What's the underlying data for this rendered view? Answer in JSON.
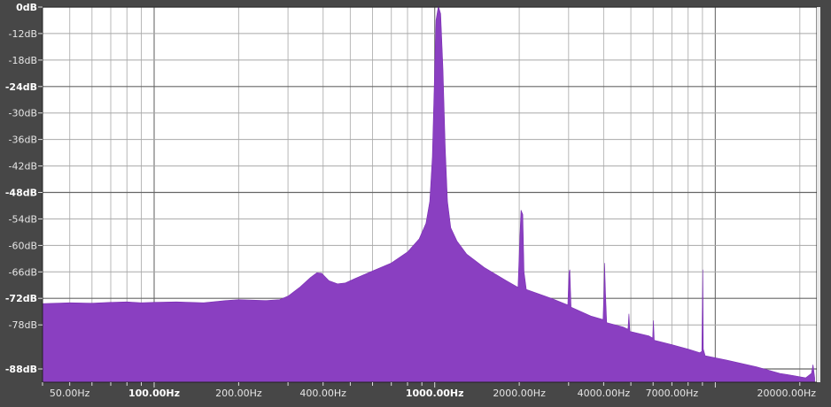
{
  "chart_data": {
    "type": "area",
    "title": "",
    "xlabel": "",
    "ylabel": "",
    "x_scale": "log",
    "xlim": [
      40,
      23000
    ],
    "ylim": [
      -91,
      -6
    ],
    "grid": true,
    "y_ticks": [
      {
        "value": -6,
        "label": "0dB",
        "major": true
      },
      {
        "value": -12,
        "label": "-12dB",
        "major": false
      },
      {
        "value": -18,
        "label": "-18dB",
        "major": false
      },
      {
        "value": -24,
        "label": "-24dB",
        "major": true
      },
      {
        "value": -30,
        "label": "-30dB",
        "major": false
      },
      {
        "value": -36,
        "label": "-36dB",
        "major": false
      },
      {
        "value": -42,
        "label": "-42dB",
        "major": false
      },
      {
        "value": -48,
        "label": "-48dB",
        "major": true
      },
      {
        "value": -54,
        "label": "-54dB",
        "major": false
      },
      {
        "value": -60,
        "label": "-60dB",
        "major": false
      },
      {
        "value": -66,
        "label": "-66dB",
        "major": false
      },
      {
        "value": -72,
        "label": "-72dB",
        "major": true
      },
      {
        "value": -78,
        "label": "-78dB",
        "major": false
      },
      {
        "value": -88,
        "label": "-88dB",
        "major": true
      }
    ],
    "x_ticks": [
      {
        "value": 50,
        "label": "50.00Hz",
        "major": false
      },
      {
        "value": 100,
        "label": "100.00Hz",
        "major": true
      },
      {
        "value": 200,
        "label": "200.00Hz",
        "major": false
      },
      {
        "value": 400,
        "label": "400.00Hz",
        "major": false
      },
      {
        "value": 1000,
        "label": "1000.00Hz",
        "major": true
      },
      {
        "value": 2000,
        "label": "2000.00Hz",
        "major": false
      },
      {
        "value": 4000,
        "label": "4000.00Hz",
        "major": false
      },
      {
        "value": 7000,
        "label": "7000.00Hz",
        "major": false
      },
      {
        "value": 20000,
        "label": "20000.00Hz",
        "major": false
      }
    ],
    "series": [
      {
        "color": "#8a3fc1",
        "points": [
          [
            40,
            -73.2
          ],
          [
            50,
            -73.0
          ],
          [
            60,
            -73.1
          ],
          [
            70,
            -72.9
          ],
          [
            80,
            -72.8
          ],
          [
            90,
            -73.0
          ],
          [
            100,
            -72.9
          ],
          [
            120,
            -72.8
          ],
          [
            150,
            -73.0
          ],
          [
            180,
            -72.5
          ],
          [
            200,
            -72.3
          ],
          [
            250,
            -72.5
          ],
          [
            280,
            -72.3
          ],
          [
            300,
            -71.5
          ],
          [
            330,
            -69.5
          ],
          [
            360,
            -67.3
          ],
          [
            380,
            -66.2
          ],
          [
            395,
            -66.3
          ],
          [
            420,
            -68.0
          ],
          [
            450,
            -68.7
          ],
          [
            480,
            -68.5
          ],
          [
            520,
            -67.5
          ],
          [
            600,
            -65.8
          ],
          [
            700,
            -64.0
          ],
          [
            800,
            -61.5
          ],
          [
            880,
            -58.5
          ],
          [
            930,
            -55.0
          ],
          [
            960,
            -50.0
          ],
          [
            980,
            -40.0
          ],
          [
            995,
            -25.0
          ],
          [
            1010,
            -9.0
          ],
          [
            1030,
            -5.8
          ],
          [
            1050,
            -7.5
          ],
          [
            1070,
            -20.0
          ],
          [
            1090,
            -38.0
          ],
          [
            1110,
            -50.0
          ],
          [
            1140,
            -56.0
          ],
          [
            1200,
            -59.0
          ],
          [
            1300,
            -62.0
          ],
          [
            1500,
            -65.0
          ],
          [
            1800,
            -68.0
          ],
          [
            1980,
            -69.5
          ],
          [
            2010,
            -58.0
          ],
          [
            2030,
            -52.0
          ],
          [
            2060,
            -53.0
          ],
          [
            2080,
            -66.0
          ],
          [
            2120,
            -70.0
          ],
          [
            2600,
            -72.0
          ],
          [
            2980,
            -73.5
          ],
          [
            3010,
            -66.0
          ],
          [
            3030,
            -65.5
          ],
          [
            3060,
            -74.0
          ],
          [
            3600,
            -76.0
          ],
          [
            3980,
            -76.8
          ],
          [
            4010,
            -70.0
          ],
          [
            4030,
            -64.0
          ],
          [
            4060,
            -71.0
          ],
          [
            4100,
            -77.5
          ],
          [
            4700,
            -78.5
          ],
          [
            4880,
            -79.0
          ],
          [
            4920,
            -75.5
          ],
          [
            4960,
            -79.5
          ],
          [
            5800,
            -80.5
          ],
          [
            5980,
            -81.0
          ],
          [
            6020,
            -77.0
          ],
          [
            6060,
            -81.5
          ],
          [
            7000,
            -82.5
          ],
          [
            8000,
            -83.5
          ],
          [
            8800,
            -84.3
          ],
          [
            8950,
            -84.0
          ],
          [
            9020,
            -65.5
          ],
          [
            9060,
            -83.5
          ],
          [
            9200,
            -85.0
          ],
          [
            11000,
            -86.0
          ],
          [
            14000,
            -87.5
          ],
          [
            17000,
            -89.0
          ],
          [
            19000,
            -89.5
          ],
          [
            21000,
            -90.0
          ],
          [
            22000,
            -89.0
          ],
          [
            22300,
            -87.0
          ],
          [
            22600,
            -90.0
          ]
        ]
      }
    ]
  }
}
